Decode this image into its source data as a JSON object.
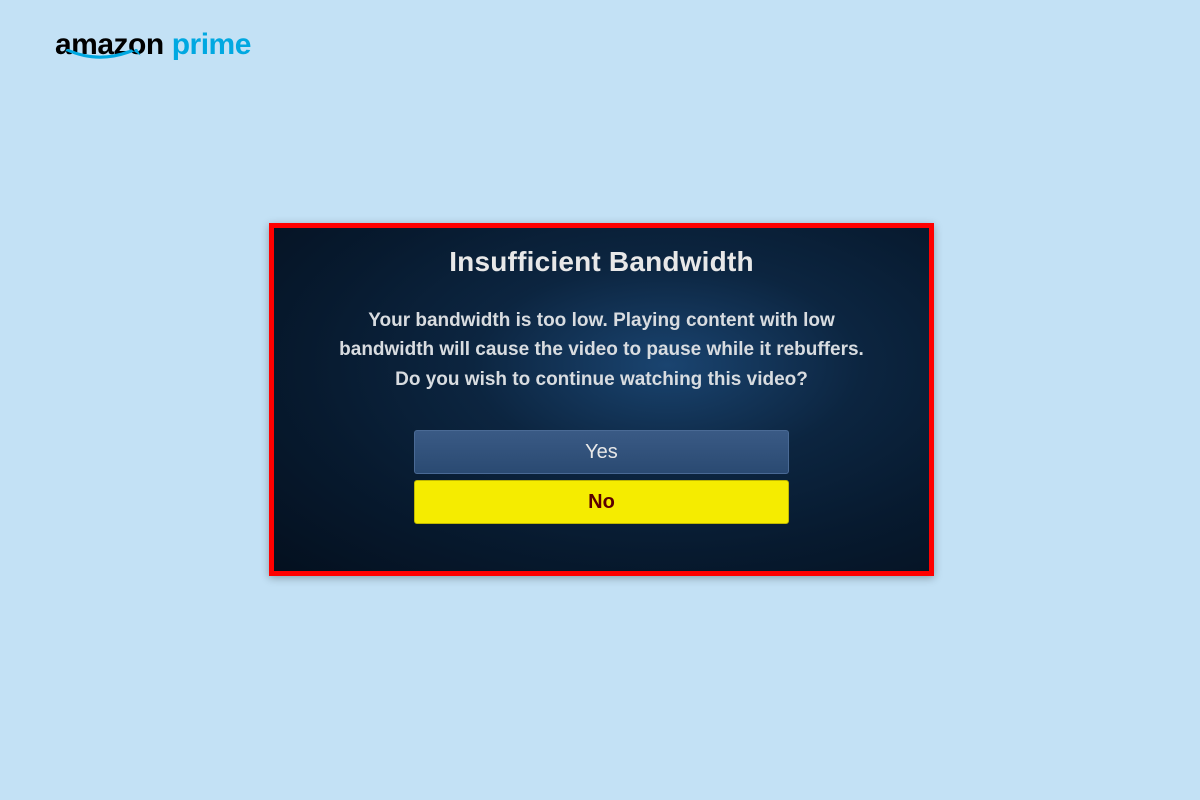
{
  "logo": {
    "amazon_text": "amazon",
    "prime_text": "prime"
  },
  "dialog": {
    "title": "Insufficient Bandwidth",
    "message": "Your bandwidth is too low. Playing content with low bandwidth will cause the video to pause while it rebuffers. Do you wish to continue watching this video?",
    "yes_label": "Yes",
    "no_label": "No"
  },
  "colors": {
    "page_bg": "#c3e1f5",
    "dialog_border": "#ff0000",
    "prime_blue": "#00a8e1",
    "btn_no_bg": "#f5ec00"
  }
}
